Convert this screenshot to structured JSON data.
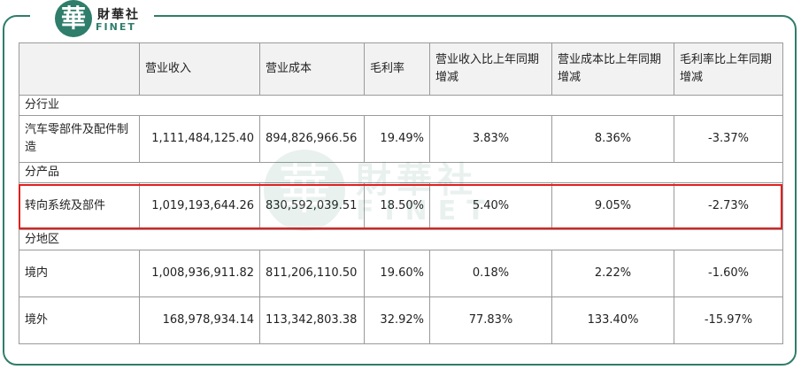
{
  "logo": {
    "symbol": "華",
    "name_cn": "財華社",
    "name_en": "FINET"
  },
  "table": {
    "headers": [
      "",
      "营业收入",
      "营业成本",
      "毛利率",
      "营业收入比上年同期 增减",
      "营业成本比上年同期 增减",
      "毛利率比上年同期增减"
    ],
    "sections": [
      {
        "title": "分行业",
        "rows": [
          {
            "name": "汽车零部件及配件制造",
            "revenue": "1,111,484,125.40",
            "cost": "894,826,966.56",
            "margin": "19.49%",
            "rev_change": "3.83%",
            "cost_change": "8.36%",
            "margin_change": "-3.37%"
          }
        ]
      },
      {
        "title": "分产品",
        "rows": [
          {
            "name": "转向系统及部件",
            "revenue": "1,019,193,644.26",
            "cost": "830,592,039.51",
            "margin": "18.50%",
            "rev_change": "5.40%",
            "cost_change": "9.05%",
            "margin_change": "-2.73%"
          }
        ]
      },
      {
        "title": "分地区",
        "rows": [
          {
            "name": "境内",
            "revenue": "1,008,936,911.82",
            "cost": "811,206,110.50",
            "margin": "19.60%",
            "rev_change": "0.18%",
            "cost_change": "2.22%",
            "margin_change": "-1.60%"
          },
          {
            "name": "境外",
            "revenue": "168,978,934.14",
            "cost": "113,342,803.38",
            "margin": "32.92%",
            "rev_change": "77.83%",
            "cost_change": "133.40%",
            "margin_change": "-15.97%"
          }
        ]
      }
    ]
  },
  "colors": {
    "brand": "#2f7d6b",
    "highlight": "#e02020",
    "header_bg": "#f2f2f2",
    "border": "#9a9a9a"
  }
}
